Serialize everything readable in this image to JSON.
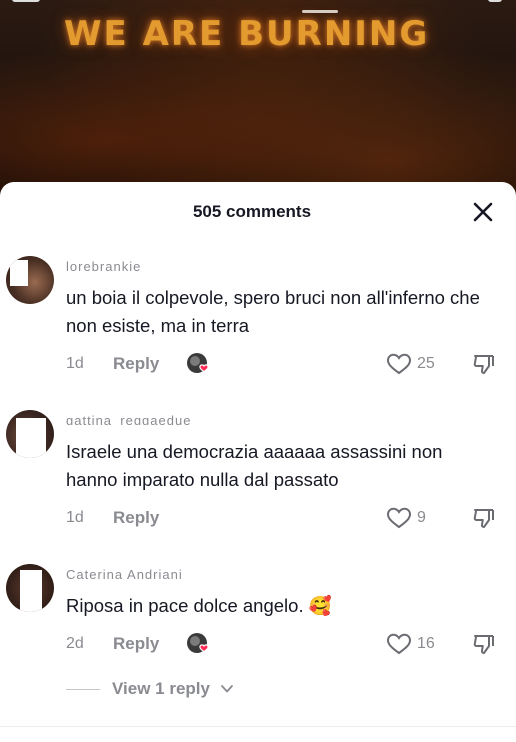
{
  "video": {
    "title": "WE ARE BURNING"
  },
  "sheet": {
    "comment_count_label": "505 comments"
  },
  "comments": [
    {
      "username": "lorebrankie",
      "text": "un boia il colpevole, spero bruci non all'inferno che non esiste, ma in terra",
      "time": "1d",
      "reply_label": "Reply",
      "likes": "25",
      "creator_liked": true
    },
    {
      "username": "gattina_reggaedue",
      "text": "Israele una democrazia aaaaaa assassini non hanno imparato nulla dal passato",
      "time": "1d",
      "reply_label": "Reply",
      "likes": "9",
      "creator_liked": false
    },
    {
      "username": "Caterina Andriani",
      "text": "Riposa in pace dolce angelo. 🥰",
      "time": "2d",
      "reply_label": "Reply",
      "likes": "16",
      "creator_liked": true
    }
  ],
  "view_replies_label": "View 1 reply",
  "colors": {
    "text": "#161823",
    "muted": "#8a8b91",
    "heart_red": "#fe2c55",
    "banner_text": "#e39a2e"
  },
  "icons": [
    "close-icon",
    "heart-outline-icon",
    "dislike-icon",
    "creator-like-icon",
    "chevron-down-icon"
  ]
}
